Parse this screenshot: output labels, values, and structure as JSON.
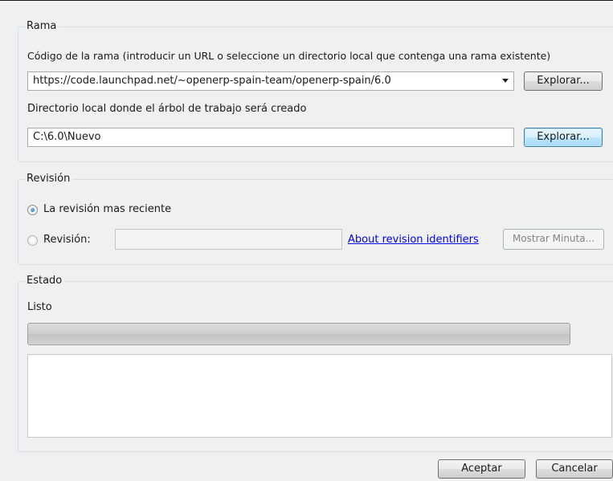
{
  "branch": {
    "group_label": "Rama",
    "source_label": "Código de la rama (introducir un URL o seleccione un directorio local que contenga una rama existente)",
    "source_value": "https://code.launchpad.net/~openerp-spain-team/openerp-spain/6.0",
    "browse1_label": "Explorar...",
    "local_label": "Directorio local donde el árbol de trabajo será creado",
    "local_value": "C:\\6.0\\Nuevo",
    "browse2_label": "Explorar..."
  },
  "revision": {
    "group_label": "Revisión",
    "option_latest": "La revisión mas reciente",
    "option_revision": "Revisión:",
    "revision_value": "",
    "link_label": "About revision identifiers",
    "show_button": "Mostrar Minuta..."
  },
  "status": {
    "group_label": "Estado",
    "text": "Listo",
    "progress": 0
  },
  "buttons": {
    "accept": "Aceptar",
    "cancel": "Cancelar"
  }
}
